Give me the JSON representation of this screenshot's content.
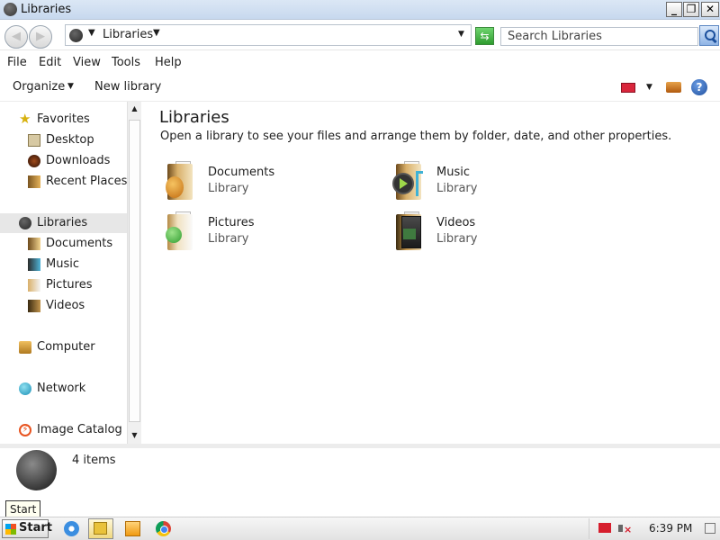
{
  "window": {
    "title": "Libraries"
  },
  "address": {
    "crumb": "Libraries"
  },
  "search": {
    "placeholder": "Search Libraries"
  },
  "menu": [
    "File",
    "Edit",
    "View",
    "Tools",
    "Help"
  ],
  "toolbar": {
    "organize": "Organize",
    "new_library": "New library",
    "help": "?"
  },
  "nav": {
    "favorites": {
      "label": "Favorites",
      "items": [
        "Desktop",
        "Downloads",
        "Recent Places"
      ]
    },
    "libraries": {
      "label": "Libraries",
      "items": [
        "Documents",
        "Music",
        "Pictures",
        "Videos"
      ]
    },
    "computer": "Computer",
    "network": "Network",
    "image_catalog": "Image Catalog"
  },
  "content": {
    "heading": "Libraries",
    "subtitle": "Open a library to see your files and arrange them by folder, date, and other properties.",
    "libraries": [
      {
        "name": "Documents",
        "type": "Library",
        "icon": "documents-library-icon"
      },
      {
        "name": "Music",
        "type": "Library",
        "icon": "music-library-icon"
      },
      {
        "name": "Pictures",
        "type": "Library",
        "icon": "pictures-library-icon"
      },
      {
        "name": "Videos",
        "type": "Library",
        "icon": "videos-library-icon"
      }
    ]
  },
  "details": {
    "count": "4 items"
  },
  "tooltip": "Start",
  "taskbar": {
    "start": "Start",
    "time": "6:39 PM"
  }
}
